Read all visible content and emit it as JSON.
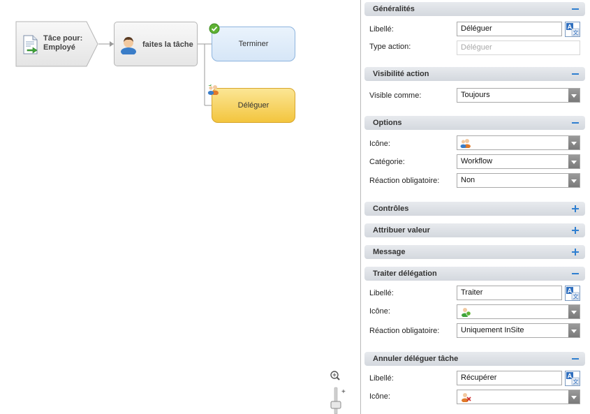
{
  "canvas": {
    "task_node": {
      "line1": "Tâce pour:",
      "line2": "Employé"
    },
    "step_node": {
      "label": "faites la tâche"
    },
    "end_node": {
      "label": "Terminer"
    },
    "deleg_node": {
      "label": "Déléguer"
    },
    "zoom": {
      "plus": "+"
    }
  },
  "panel": {
    "generalites": {
      "title": "Généralités",
      "libelle_label": "Libellé:",
      "libelle_value": "Déléguer",
      "type_label": "Type action:",
      "type_value": "Déléguer"
    },
    "visibilite": {
      "title": "Visibilité action",
      "visible_label": "Visible comme:",
      "visible_value": "Toujours"
    },
    "options": {
      "title": "Options",
      "icone_label": "Icône:",
      "categorie_label": "Catégorie:",
      "categorie_value": "Workflow",
      "reaction_label": "Réaction obligatoire:",
      "reaction_value": "Non"
    },
    "controles": {
      "title": "Contrôles"
    },
    "attribuer": {
      "title": "Attribuer valeur"
    },
    "message": {
      "title": "Message"
    },
    "traiter": {
      "title": "Traiter délégation",
      "libelle_label": "Libellé:",
      "libelle_value": "Traiter",
      "icone_label": "Icône:",
      "reaction_label": "Réaction obligatoire:",
      "reaction_value": "Uniquement InSite"
    },
    "annuler": {
      "title": "Annuler déléguer tâche",
      "libelle_label": "Libellé:",
      "libelle_value": "Récupérer",
      "icone_label": "Icône:"
    }
  },
  "colors": {
    "accent": "#2f7fd0",
    "end_node": "#d6e6f7",
    "deleg_node": "#f3c53e",
    "check": "#5fb233"
  }
}
